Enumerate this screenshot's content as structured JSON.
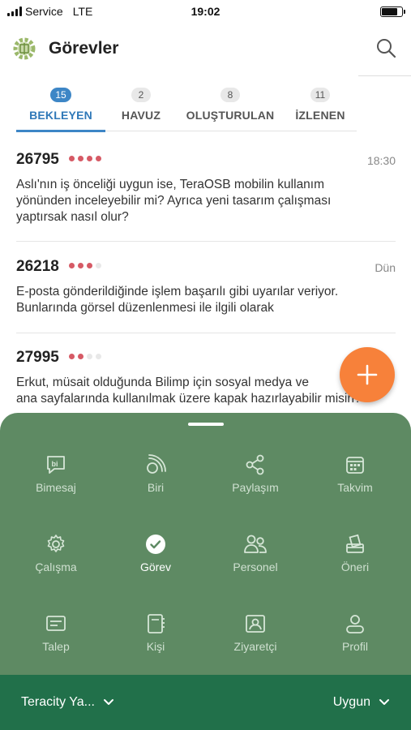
{
  "status_bar": {
    "carrier": "Service",
    "network": "LTE",
    "time": "19:02"
  },
  "header": {
    "title": "Görevler"
  },
  "tabs": [
    {
      "count": "15",
      "label": "BEKLEYEN",
      "active": true
    },
    {
      "count": "2",
      "label": "HAVUZ",
      "active": false
    },
    {
      "count": "8",
      "label": "OLUŞTURULAN",
      "active": false
    },
    {
      "count": "11",
      "label": "İZLENEN",
      "active": false
    }
  ],
  "tasks": [
    {
      "id": "26795",
      "priority": 4,
      "time": "18:30",
      "lines": [
        "Aslı'nın iş önceliği uygun ise, TeraOSB mobilin kullanım",
        "yönünden inceleyebilir mi? Ayrıca yeni tasarım çalışması",
        "yaptırsak nasıl olur?"
      ]
    },
    {
      "id": "26218",
      "priority": 3,
      "time": "Dün",
      "lines": [
        "E-posta gönderildiğinde işlem başarılı gibi uyarılar veriyor.",
        "Bunlarında görsel düzenlenmesi ile ilgili olarak"
      ]
    },
    {
      "id": "27995",
      "priority": 2,
      "time": "",
      "lines": [
        "Erkut, müsait olduğunda Bilimp için sosyal medya ve",
        "ana sayfalarında kullanılmak üzere kapak hazırlayabilir misin?"
      ]
    }
  ],
  "menu": [
    {
      "label": "Bimesaj",
      "icon": "bimesaj-icon",
      "selected": false
    },
    {
      "label": "Biri",
      "icon": "biri-icon",
      "selected": false
    },
    {
      "label": "Paylaşım",
      "icon": "share-icon",
      "selected": false
    },
    {
      "label": "Takvim",
      "icon": "calendar-icon",
      "selected": false
    },
    {
      "label": "Çalışma",
      "icon": "gear-icon",
      "selected": false
    },
    {
      "label": "Görev",
      "icon": "check-circle-icon",
      "selected": true
    },
    {
      "label": "Personel",
      "icon": "people-icon",
      "selected": false
    },
    {
      "label": "Öneri",
      "icon": "ballot-box-icon",
      "selected": false
    },
    {
      "label": "Talep",
      "icon": "request-icon",
      "selected": false
    },
    {
      "label": "Kişi",
      "icon": "contact-book-icon",
      "selected": false
    },
    {
      "label": "Ziyaretçi",
      "icon": "visitor-card-icon",
      "selected": false
    },
    {
      "label": "Profil",
      "icon": "profile-icon",
      "selected": false
    }
  ],
  "footer": {
    "company": "Teracity Ya...",
    "status": "Uygun"
  },
  "colors": {
    "accent": "#3d86c6",
    "fab": "#f7813a",
    "sheet": "#5e8a63",
    "footer": "#21704a",
    "priority": "#d65a65"
  }
}
